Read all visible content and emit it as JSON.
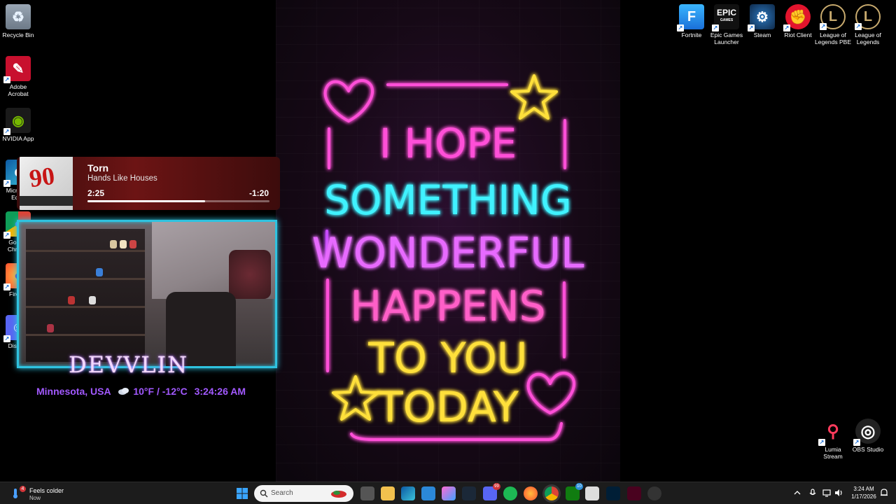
{
  "desktop_icons_left": [
    {
      "label": "Recycle Bin",
      "icon": "recycle-bin-icon"
    },
    {
      "label": "Adobe Acrobat",
      "icon": "adobe-acrobat-icon"
    },
    {
      "label": "NVIDIA App",
      "icon": "nvidia-icon"
    },
    {
      "label": "Microsoft Edge",
      "icon": "edge-icon"
    },
    {
      "label": "Google Chrome",
      "icon": "chrome-icon"
    },
    {
      "label": "Firefox",
      "icon": "firefox-icon"
    },
    {
      "label": "Discord",
      "icon": "discord-icon"
    }
  ],
  "desktop_icons_right": [
    {
      "label": "Fortnite",
      "icon": "fortnite-icon"
    },
    {
      "label": "Epic Games Launcher",
      "icon": "epic-games-icon"
    },
    {
      "label": "Steam",
      "icon": "steam-icon"
    },
    {
      "label": "Riot Client",
      "icon": "riot-client-icon"
    },
    {
      "label": "League of Legends PBE",
      "icon": "league-pbe-icon"
    },
    {
      "label": "League of Legends",
      "icon": "league-icon"
    }
  ],
  "desktop_icons_bottom_right": [
    {
      "label": "Lumia Stream",
      "icon": "lumia-stream-icon"
    },
    {
      "label": "OBS Studio",
      "icon": "obs-icon"
    }
  ],
  "icon_glyphs": {
    "epic": "EPIC",
    "epic_sub": "GAMES",
    "fortnite": "F",
    "album_number": "90"
  },
  "now_playing": {
    "title": "Torn",
    "artist": "Hands Like Houses",
    "elapsed": "2:25",
    "remaining": "-1:20",
    "progress": 0.645
  },
  "overlay": {
    "streamer": "DEVVLIN",
    "location": "Minnesota, USA",
    "temperature": "10°F / -12°C",
    "time": "3:24:26 AM"
  },
  "wallpaper": {
    "lines": [
      "I HOPE",
      "SOMETHING",
      "WONDERFUL",
      "HAPPENS",
      "TO YOU",
      "TODAY"
    ],
    "colors": [
      "#ff4fd8",
      "#3ff2ff",
      "#e76bff",
      "#ff5fc8",
      "#ffe03a",
      "#ffe03a"
    ]
  },
  "taskbar": {
    "weather_condition": "Feels colder",
    "weather_time": "Now",
    "weather_badge": "4",
    "search_placeholder": "Search",
    "clock_time": "3:24 AM",
    "clock_date": "1/17/2026",
    "discord_badge": "99",
    "xbox_badge": "10"
  }
}
